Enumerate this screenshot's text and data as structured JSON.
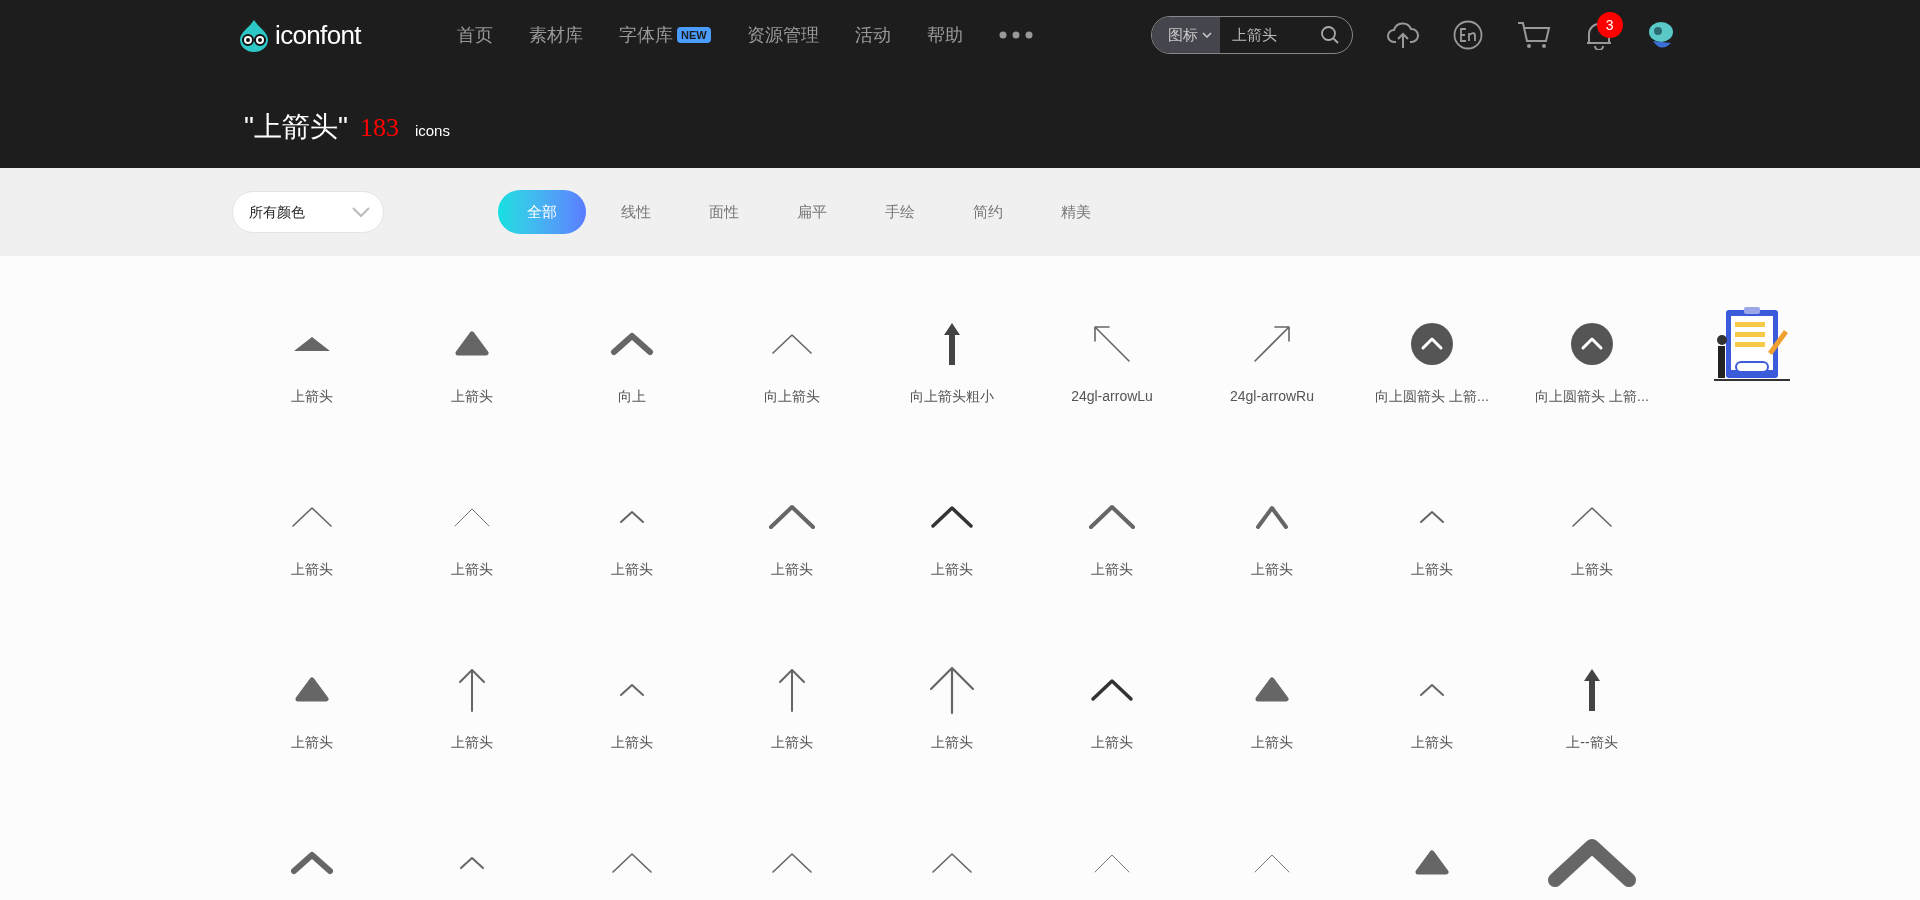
{
  "header": {
    "logo": "iconfont",
    "nav": [
      {
        "label": "首页"
      },
      {
        "label": "素材库"
      },
      {
        "label": "字体库",
        "badge": "NEW"
      },
      {
        "label": "资源管理"
      },
      {
        "label": "活动"
      },
      {
        "label": "帮助"
      }
    ],
    "search": {
      "category": "图标",
      "value": "上箭头"
    },
    "notifications": "3"
  },
  "results": {
    "query": "\"上箭头\"",
    "count": "183",
    "unit": "icons"
  },
  "filters": {
    "color_filter": "所有颜色",
    "styles": [
      {
        "label": "全部",
        "selected": true
      },
      {
        "label": "线性",
        "selected": false
      },
      {
        "label": "面性",
        "selected": false
      },
      {
        "label": "扁平",
        "selected": false
      },
      {
        "label": "手绘",
        "selected": false
      },
      {
        "label": "简约",
        "selected": false
      },
      {
        "label": "精美",
        "selected": false
      }
    ]
  },
  "rows": [
    [
      {
        "kind": "triangle",
        "label": "上箭头"
      },
      {
        "kind": "roundtriangle",
        "label": "上箭头"
      },
      {
        "kind": "boldchevron",
        "label": "向上"
      },
      {
        "kind": "thinchevron",
        "label": "向上箭头"
      },
      {
        "kind": "bolduparrow",
        "label": "向上箭头粗小"
      },
      {
        "kind": "northwest",
        "label": "24gl-arrowLu"
      },
      {
        "kind": "northeast",
        "label": "24gl-arrowRu"
      },
      {
        "kind": "circle",
        "label": "向上圆箭头 上箭..."
      },
      {
        "kind": "circle",
        "label": "向上圆箭头 上箭..."
      },
      {
        "kind": "promo"
      }
    ],
    [
      {
        "kind": "thinchevron",
        "label": "上箭头"
      },
      {
        "kind": "hairchevron",
        "label": "上箭头"
      },
      {
        "kind": "smallchevron",
        "label": "上箭头"
      },
      {
        "kind": "chevron",
        "label": "上箭头"
      },
      {
        "kind": "darkchevron",
        "label": "上箭头"
      },
      {
        "kind": "chevron",
        "label": "上箭头"
      },
      {
        "kind": "tallchevron",
        "label": "上箭头"
      },
      {
        "kind": "smallchevron",
        "label": "上箭头"
      },
      {
        "kind": "thinchevron",
        "label": "上箭头"
      }
    ],
    [
      {
        "kind": "roundtriangle",
        "label": "上箭头"
      },
      {
        "kind": "linearrow",
        "label": "上箭头"
      },
      {
        "kind": "smallchevron",
        "label": "上箭头"
      },
      {
        "kind": "linearrow",
        "label": "上箭头"
      },
      {
        "kind": "widearrow",
        "label": "上箭头"
      },
      {
        "kind": "darkchevron",
        "label": "上箭头"
      },
      {
        "kind": "roundtriangle",
        "label": "上箭头"
      },
      {
        "kind": "smallchevron",
        "label": "上箭头"
      },
      {
        "kind": "bolduparrow",
        "label": "上--箭头"
      }
    ],
    [
      {
        "kind": "boldchevron"
      },
      {
        "kind": "smallchevron"
      },
      {
        "kind": "thinchevron"
      },
      {
        "kind": "thinchevron"
      },
      {
        "kind": "thinchevron"
      },
      {
        "kind": "hairchevron"
      },
      {
        "kind": "hairchevron"
      },
      {
        "kind": "roundtriangle"
      },
      {
        "kind": "jumbochevron"
      }
    ]
  ]
}
